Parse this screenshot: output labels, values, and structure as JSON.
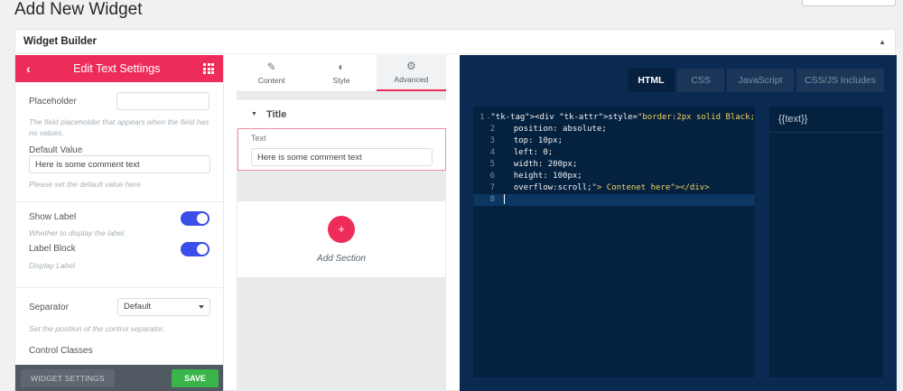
{
  "page": {
    "title": "Add New Widget"
  },
  "card": {
    "title": "Widget Builder"
  },
  "left_panel": {
    "title": "Edit Text Settings",
    "placeholder": {
      "label": "Placeholder",
      "value": "",
      "description": "The field placeholder that appears when the field has no values."
    },
    "default_value": {
      "label": "Default Value",
      "value": "Here is some comment text",
      "description": "Please set the default value here"
    },
    "show_label": {
      "label": "Show Label",
      "description": "Whether to display the label.",
      "on": true
    },
    "label_block": {
      "label": "Label Block",
      "description": "Display Label",
      "on": true
    },
    "separator": {
      "label": "Separator",
      "selected": "Default",
      "description": "Set the position of the control separator."
    },
    "control_classes": {
      "label": "Control Classes"
    },
    "footer": {
      "widget_settings": "WIDGET SETTINGS",
      "save": "SAVE"
    }
  },
  "middle_panel": {
    "tabs": [
      {
        "label": "Content",
        "icon": "pencil-icon"
      },
      {
        "label": "Style",
        "icon": "half-circle-icon"
      },
      {
        "label": "Advanced",
        "icon": "gear-icon",
        "active": true
      }
    ],
    "section_title": "Title",
    "text_control": {
      "label": "Text",
      "value": "Here is some comment text"
    },
    "add_section_label": "Add Section"
  },
  "code_panel": {
    "tabs": [
      {
        "label": "HTML",
        "active": true
      },
      {
        "label": "CSS"
      },
      {
        "label": "JavaScript"
      },
      {
        "label": "CSS/JS Includes"
      }
    ],
    "line_numbers": [
      "1",
      "2",
      "3",
      "4",
      "5",
      "6",
      "7",
      "8"
    ],
    "lines": [
      "<div style=\"border:2px solid Black;",
      "  position: absolute;",
      "  top: 10px;",
      "  left: 0;",
      "  width: 200px;",
      "  height: 100px;",
      "  overflow:scroll;\"> Contenet here</div>",
      ""
    ],
    "preview_text": "{{text}}"
  },
  "colors": {
    "accent": "#ee2c5a",
    "toggle": "#3a4ee8",
    "save": "#39b54a",
    "code_bg": "#0a2a52"
  }
}
